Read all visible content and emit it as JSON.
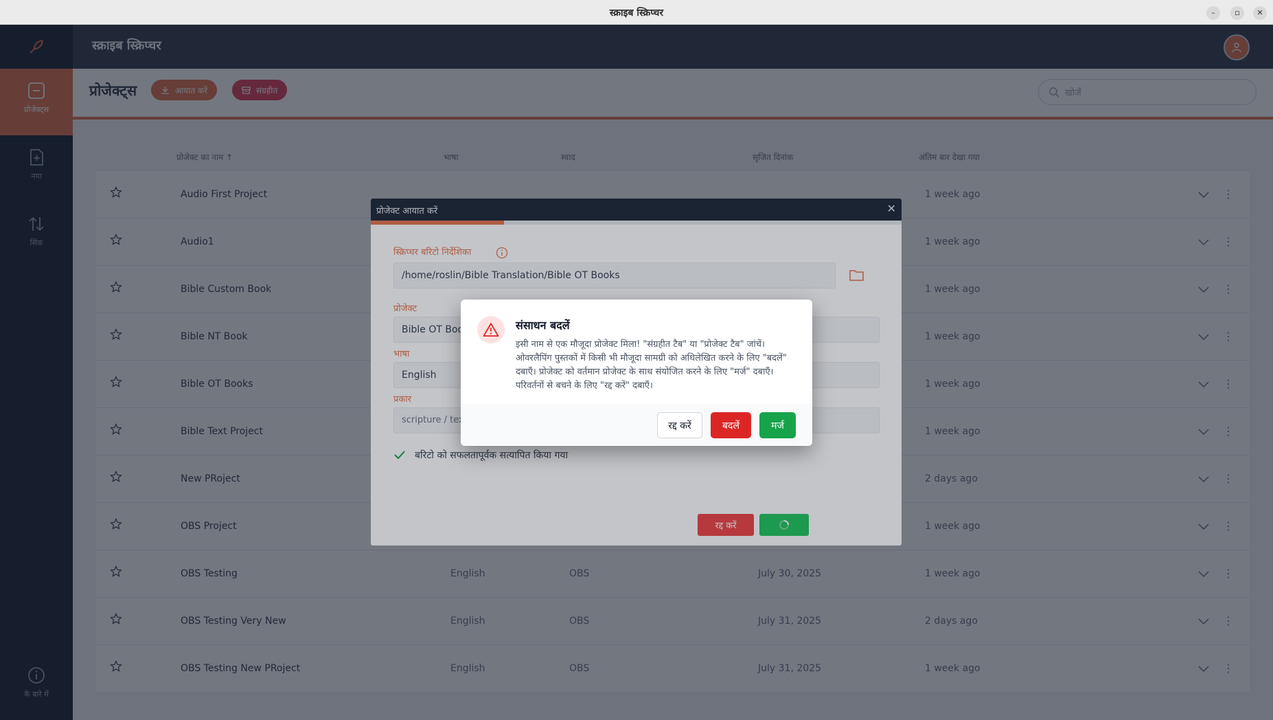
{
  "window": {
    "title": "स्क्राइब स्क्रिप्चर"
  },
  "header": {
    "brand": "स्क्राइब स्क्रिप्चर"
  },
  "sidebar": {
    "items": [
      {
        "label": "प्रोजेक्ट्स",
        "icon": "projects-icon"
      },
      {
        "label": "नया",
        "icon": "new-icon"
      },
      {
        "label": "सिंक",
        "icon": "sync-icon"
      },
      {
        "label": "के बारे में",
        "icon": "info-icon"
      }
    ]
  },
  "toolbar": {
    "title": "प्रोजेक्ट्स",
    "import_label": "आयात करें",
    "archive_label": "संग्रहीत",
    "search_placeholder": "खोजें"
  },
  "table": {
    "headers": {
      "name": "प्रोजेक्ट का नाम",
      "language": "भाषा",
      "flavor": "स्वाद",
      "created": "सृजित दिनांक",
      "viewed": "अंतिम बार देखा गया"
    },
    "rows": [
      {
        "name": "Audio First Project",
        "language": "",
        "flavor": "",
        "created": "",
        "viewed": "1 week ago"
      },
      {
        "name": "Audio1",
        "language": "",
        "flavor": "",
        "created": "",
        "viewed": "1 week ago"
      },
      {
        "name": "Bible Custom Book",
        "language": "",
        "flavor": "",
        "created": "",
        "viewed": "1 week ago"
      },
      {
        "name": "Bible NT Book",
        "language": "",
        "flavor": "",
        "created": "",
        "viewed": "1 week ago"
      },
      {
        "name": "Bible OT Books",
        "language": "",
        "flavor": "",
        "created": "",
        "viewed": "1 week ago"
      },
      {
        "name": "Bible Text Project",
        "language": "",
        "flavor": "",
        "created": "",
        "viewed": "1 week ago"
      },
      {
        "name": "New PRoject",
        "language": "",
        "flavor": "",
        "created": "",
        "viewed": "2 days ago"
      },
      {
        "name": "OBS Project",
        "language": "",
        "flavor": "",
        "created": "",
        "viewed": "1 week ago"
      },
      {
        "name": "OBS Testing",
        "language": "English",
        "flavor": "OBS",
        "created": "July 30, 2025",
        "viewed": "1 week ago"
      },
      {
        "name": "OBS Testing Very New",
        "language": "English",
        "flavor": "OBS",
        "created": "July 31, 2025",
        "viewed": "2 days ago"
      },
      {
        "name": "OBS Testing New PRoject",
        "language": "English",
        "flavor": "OBS",
        "created": "July 31, 2025",
        "viewed": "1 week ago"
      }
    ]
  },
  "import_modal": {
    "title": "प्रोजेक्ट आयात करें",
    "dir_label": "स्क्रिप्चर बरिटो निर्देशिका",
    "dir_value": "/home/roslin/Bible Translation/Bible OT Books",
    "project_label": "प्रोजेक्ट",
    "project_value": "Bible OT Book",
    "language_label": "भाषा",
    "language_value": "English",
    "type_label": "प्रकार",
    "type_value": "scripture / textTranslation",
    "verified_text": "बरिटो को सफलतापूर्वक सत्यापित किया गया",
    "cancel_label": "रद्द करें"
  },
  "confirm_dialog": {
    "title": "संसाधन बदलें",
    "message": "इसी नाम से एक मौजूदा प्रोजेक्ट मिला! \"संग्रहीत टैब\" या \"प्रोजेक्ट टैब\" जांचें। ओवरलैपिंग पुस्तकों में किसी भी मौजूदा सामग्री को अधिलेखित करने के लिए \"बदलें\" दबाएँ। प्रोजेक्ट को वर्तमान प्रोजेक्ट के साथ संयोजित करने के लिए \"मर्ज\" दबाएँ। परिवर्तनों से बचने के लिए \"रद्द करें\" दबाएँ।",
    "cancel_label": "रद्द करें",
    "replace_label": "बदलें",
    "merge_label": "मर्ज"
  },
  "colors": {
    "accent": "#e4744e",
    "danger": "#dc2626",
    "success": "#16a34a",
    "sidebar": "#1f2937"
  }
}
